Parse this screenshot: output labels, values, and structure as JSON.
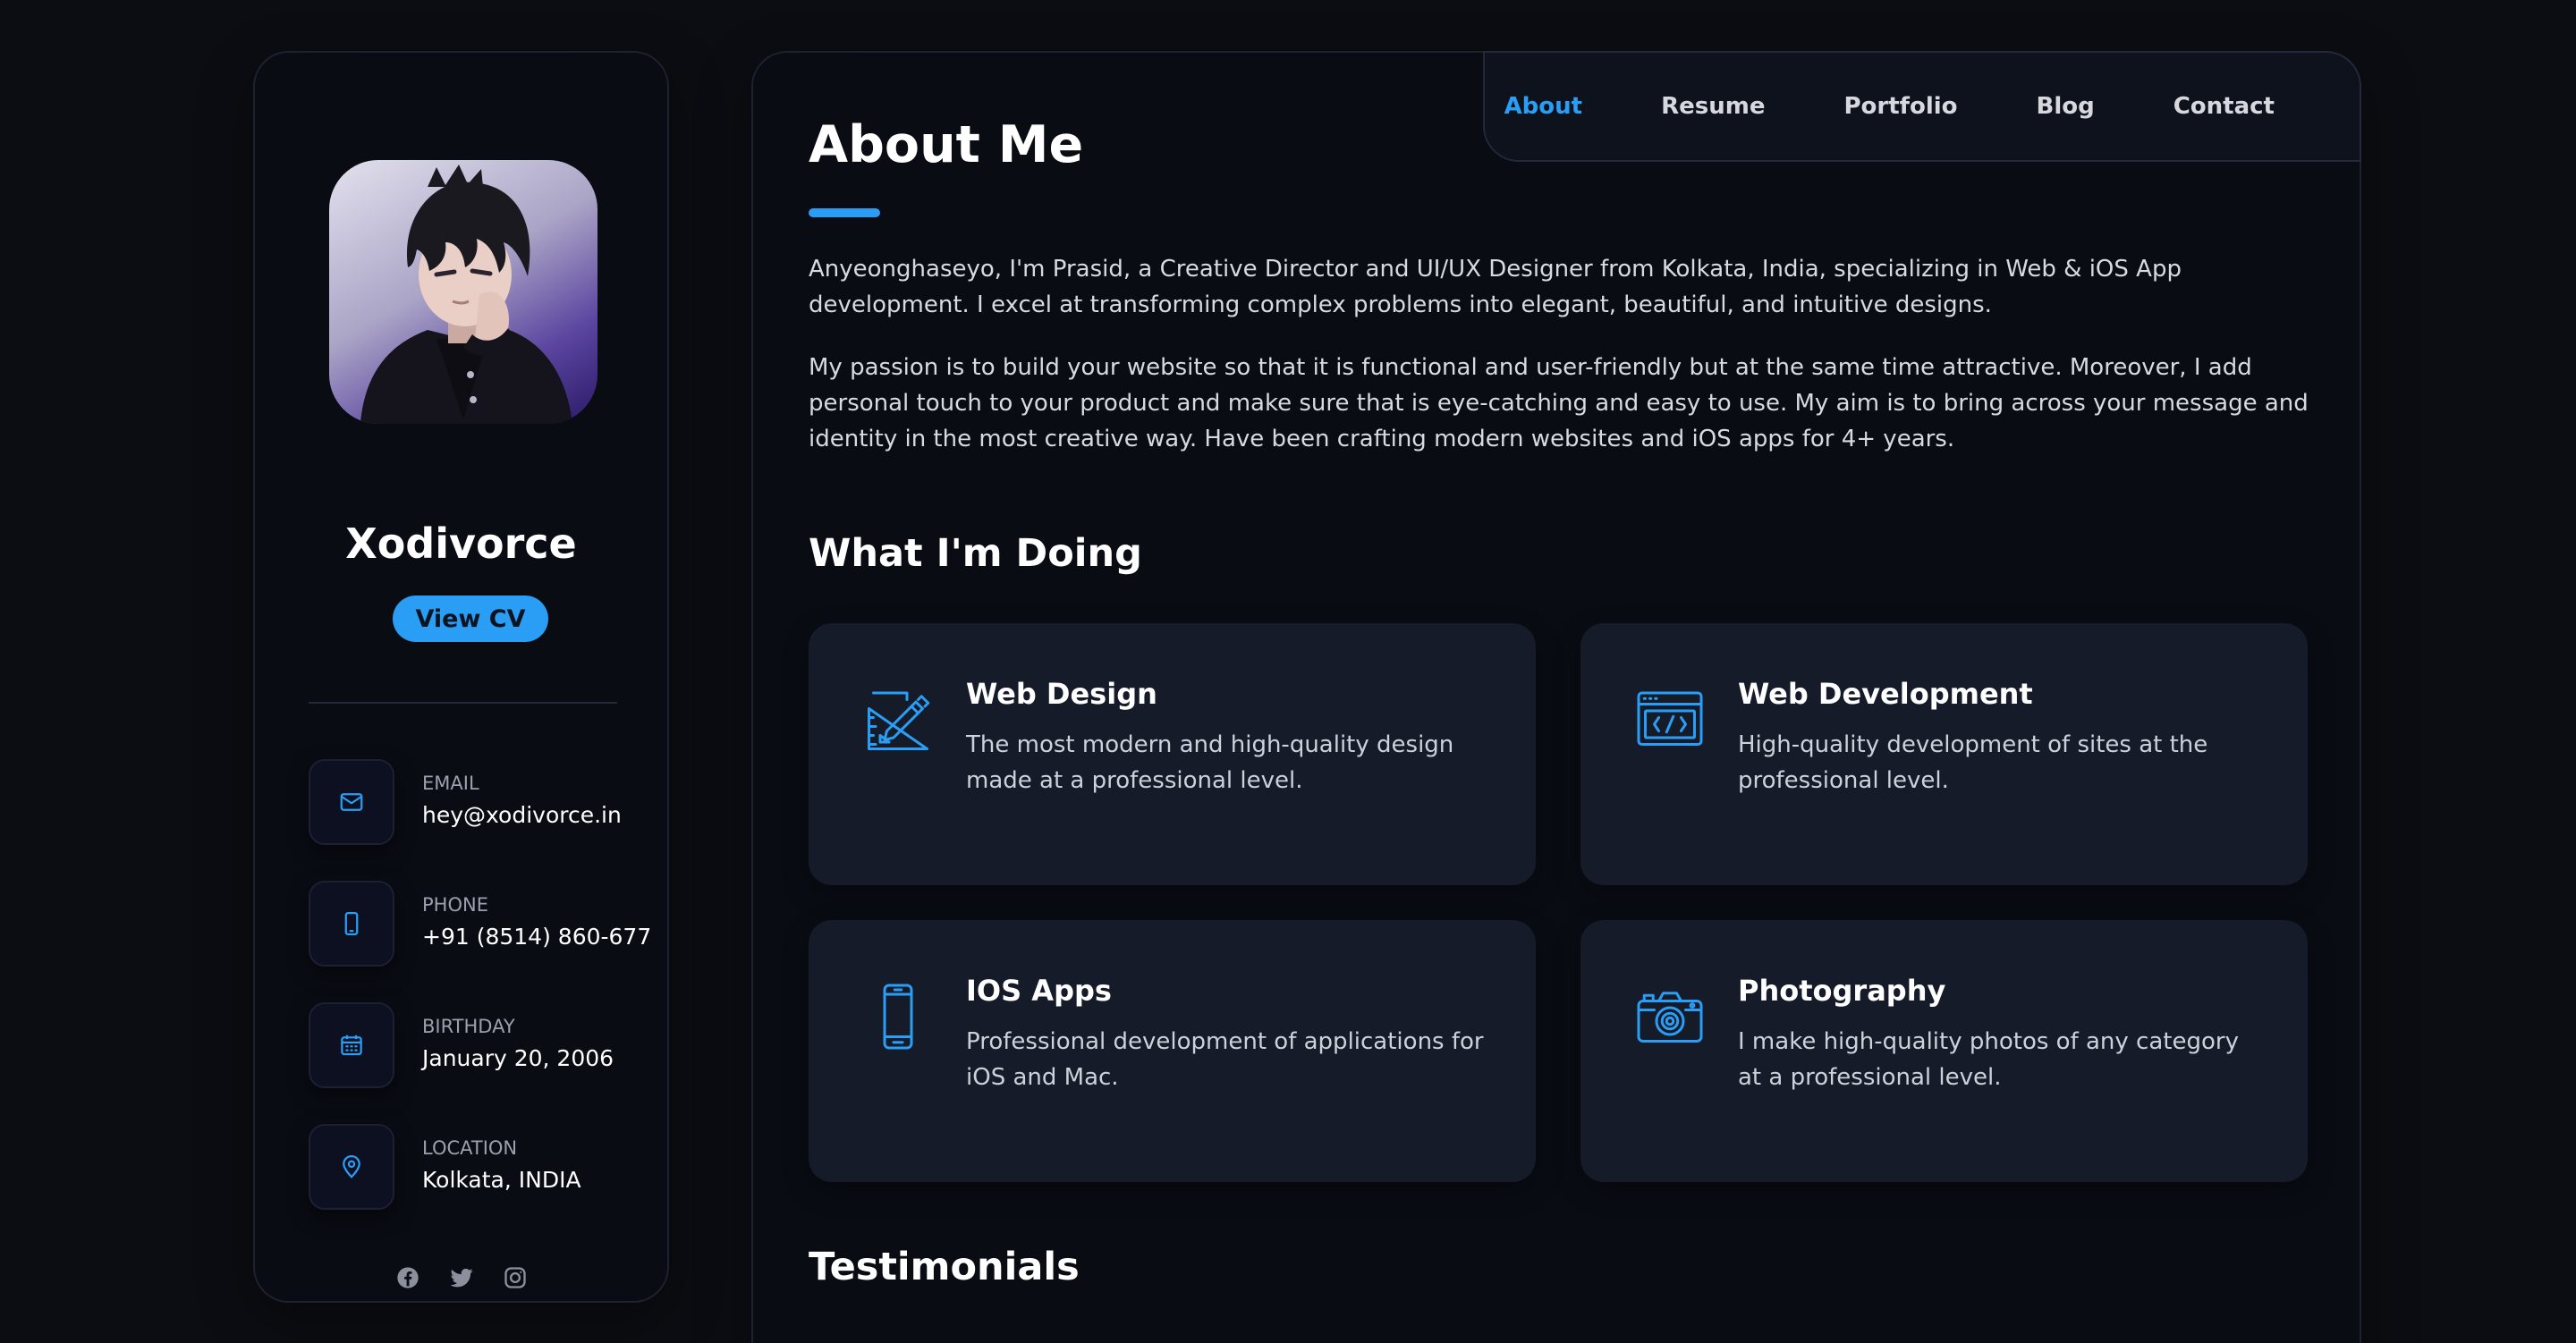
{
  "profile": {
    "name": "Xodivorce",
    "cv_button": "View CV"
  },
  "contacts": [
    {
      "label": "EMAIL",
      "value": "hey@xodivorce.in",
      "icon": "mail-icon"
    },
    {
      "label": "PHONE",
      "value": "+91 (8514) 860-677",
      "icon": "phone-icon"
    },
    {
      "label": "BIRTHDAY",
      "value": "January 20, 2006",
      "icon": "calendar-icon"
    },
    {
      "label": "LOCATION",
      "value": "Kolkata, INDIA",
      "icon": "location-pin-icon"
    }
  ],
  "socials": [
    "facebook-icon",
    "twitter-icon",
    "instagram-icon"
  ],
  "nav": {
    "items": [
      {
        "label": "About",
        "active": true
      },
      {
        "label": "Resume",
        "active": false
      },
      {
        "label": "Portfolio",
        "active": false
      },
      {
        "label": "Blog",
        "active": false
      },
      {
        "label": "Contact",
        "active": false
      }
    ]
  },
  "about": {
    "title": "About Me",
    "paragraphs": [
      "Anyeonghaseyo, I'm Prasid, a Creative Director and UI/UX Designer from Kolkata, India, specializing in Web & iOS App development. I excel at transforming complex problems into elegant, beautiful, and intuitive designs.",
      "My passion is to build your website so that it is functional and user-friendly but at the same time attractive. Moreover, I add personal touch to your product and make sure that is eye-catching and easy to use. My aim is to bring across your message and identity in the most creative way. Have been crafting modern websites and iOS apps for 4+ years."
    ]
  },
  "services": {
    "title": "What I'm Doing",
    "items": [
      {
        "title": "Web Design",
        "description": "The most modern and high-quality design made at a professional level.",
        "icon": "design-icon"
      },
      {
        "title": "Web Development",
        "description": "High-quality development of sites at the professional level.",
        "icon": "code-window-icon"
      },
      {
        "title": "IOS Apps",
        "description": "Professional development of applications for iOS and Mac.",
        "icon": "smartphone-icon"
      },
      {
        "title": "Photography",
        "description": "I make high-quality photos of any category at a professional level.",
        "icon": "camera-icon"
      }
    ]
  },
  "testimonials": {
    "title": "Testimonials"
  },
  "colors": {
    "accent": "#2a9df4",
    "background": "#0b0d12",
    "card": "#161b29"
  }
}
